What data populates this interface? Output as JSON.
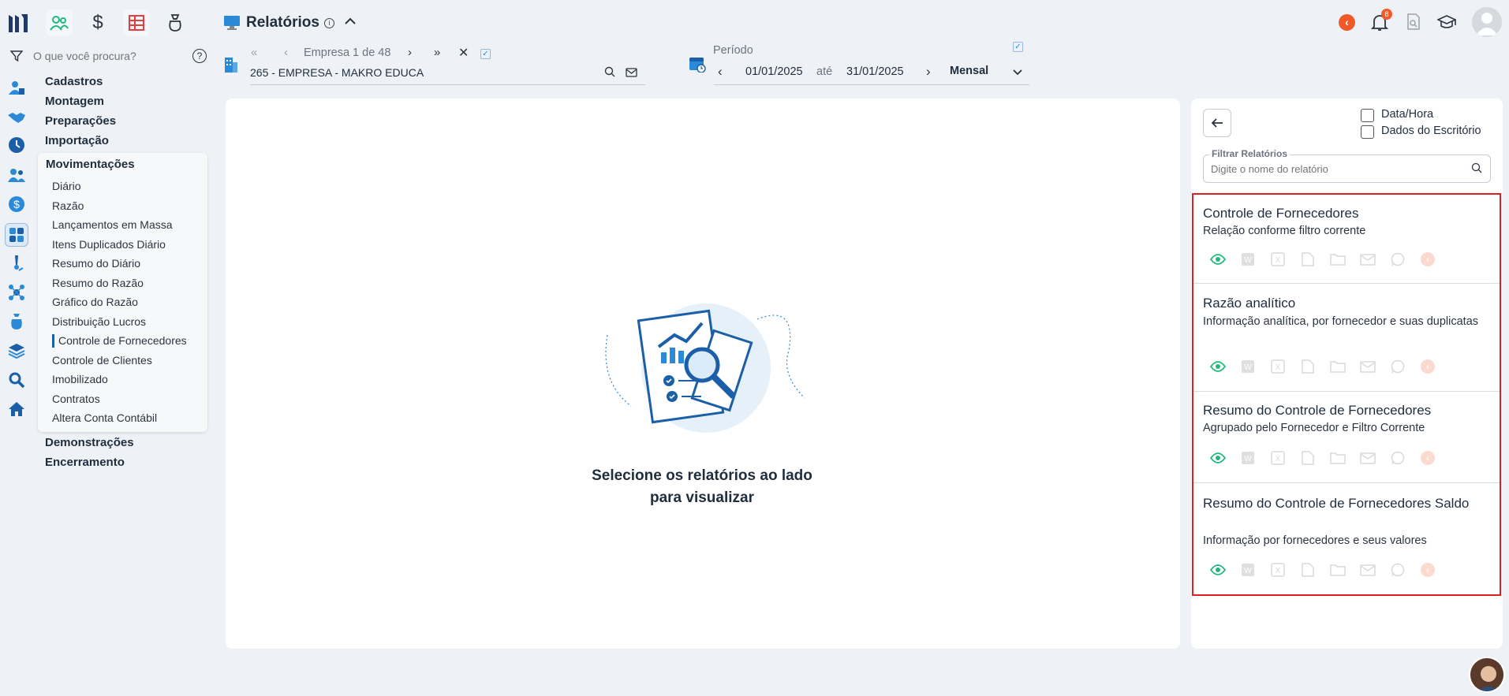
{
  "app": {
    "title": "Relatórios",
    "search_placeholder": "O que você procura?"
  },
  "company": {
    "nav_label": "Empresa 1 de 48",
    "value": "265 - EMPRESA - MAKRO EDUCA"
  },
  "period": {
    "label": "Período",
    "start": "01/01/2025",
    "sep": "até",
    "end": "31/01/2025",
    "frequency": "Mensal"
  },
  "notifications": {
    "count": "8"
  },
  "menu": {
    "top": [
      "Cadastros",
      "Montagem",
      "Preparações",
      "Importação"
    ],
    "section": "Movimentações",
    "items": [
      "Diário",
      "Razão",
      "Lançamentos em Massa",
      "Itens Duplicados Diário",
      "Resumo do Diário",
      "Resumo do Razão",
      "Gráfico do Razão",
      "Distribuição Lucros",
      "Controle de Fornecedores",
      "Controle de Clientes",
      "Imobilizado",
      "Contratos",
      "Altera Conta Contábil"
    ],
    "active": "Controle de Fornecedores",
    "bottom": [
      "Demonstrações",
      "Encerramento"
    ]
  },
  "center": {
    "line1": "Selecione os relatórios ao lado",
    "line2": "para visualizar"
  },
  "right": {
    "options": [
      "Data/Hora",
      "Dados do Escritório"
    ],
    "filter_label": "Filtrar Relatórios",
    "filter_placeholder": "Digite o nome do relatório",
    "reports": [
      {
        "title": "Controle de Fornecedores",
        "desc": "Relação conforme filtro corrente"
      },
      {
        "title": "Razão analítico",
        "desc": "Informação analítica, por fornecedor e suas duplicatas"
      },
      {
        "title": "Resumo do Controle de Fornecedores",
        "desc": "Agrupado pelo Fornecedor e Filtro Corrente"
      },
      {
        "title": "Resumo do Controle de Fornecedores Saldo",
        "desc": "Informação por fornecedores e seus valores"
      }
    ]
  },
  "colors": {
    "accent": "#1a5fa8",
    "green": "#1fb87e",
    "red": "#e02020",
    "orange": "#f05a28"
  }
}
